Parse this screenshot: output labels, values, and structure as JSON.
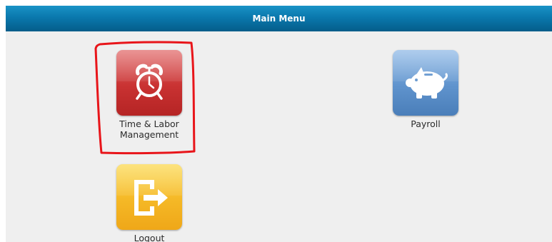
{
  "header": {
    "title": "Main Menu"
  },
  "tiles": [
    {
      "label": "Time & Labor Management",
      "icon": "alarm-clock-icon",
      "color": "#c93232"
    },
    {
      "label": "Payroll",
      "icon": "piggy-bank-icon",
      "color": "#5f93cd"
    },
    {
      "label": "Logout",
      "icon": "logout-icon",
      "color": "#f5b826"
    }
  ],
  "annotation": {
    "highlight_color": "#e8151a"
  }
}
